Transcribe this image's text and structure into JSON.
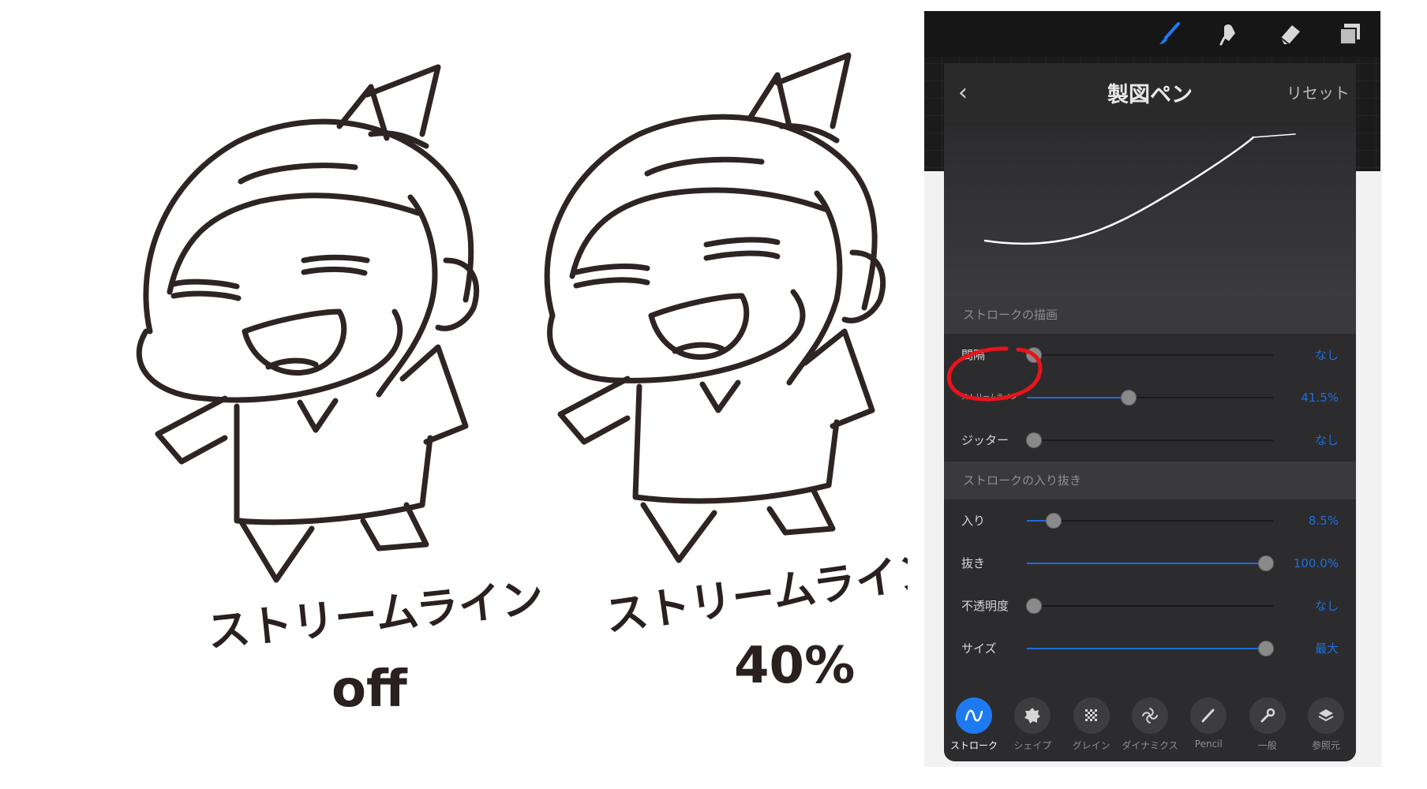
{
  "captions": {
    "left_line1": "ストリームライン",
    "left_line2": "off",
    "right_line1": "ストリームライン",
    "right_line2": "40%"
  },
  "toolbar": {
    "tools": [
      "brush-icon",
      "smudge-icon",
      "eraser-icon",
      "layers-icon"
    ],
    "accent": "#1e6dd8"
  },
  "brush_panel": {
    "back_icon": "chevron-left-icon",
    "title": "製図ペン",
    "reset_label": "リセット",
    "sections": [
      {
        "label": "ストロークの描画",
        "rows": [
          {
            "label": "間隔",
            "value": "なし",
            "level": 0.03
          },
          {
            "label": "ストリームライン",
            "value": "41.5%",
            "level": 0.415
          },
          {
            "label": "ジッター",
            "value": "なし",
            "level": 0.03
          }
        ]
      },
      {
        "label": "ストロークの入り抜き",
        "rows": [
          {
            "label": "入り",
            "value": "8.5%",
            "level": 0.11
          },
          {
            "label": "抜き",
            "value": "100.0%",
            "level": 0.97
          },
          {
            "label": "不透明度",
            "value": "なし",
            "level": 0.03
          },
          {
            "label": "サイズ",
            "value": "最大",
            "level": 0.97
          }
        ]
      }
    ],
    "tabs": [
      {
        "label": "ストローク",
        "icon": "stroke-icon",
        "active": true
      },
      {
        "label": "シェイプ",
        "icon": "shape-icon",
        "active": false
      },
      {
        "label": "グレイン",
        "icon": "grain-icon",
        "active": false
      },
      {
        "label": "ダイナミクス",
        "icon": "dynamics-icon",
        "active": false
      },
      {
        "label": "Pencil",
        "icon": "pencil-icon",
        "active": false
      },
      {
        "label": "一般",
        "icon": "wrench-icon",
        "active": false
      },
      {
        "label": "参照元",
        "icon": "source-icon",
        "active": false
      }
    ]
  },
  "annotation_color": "#e8141c"
}
